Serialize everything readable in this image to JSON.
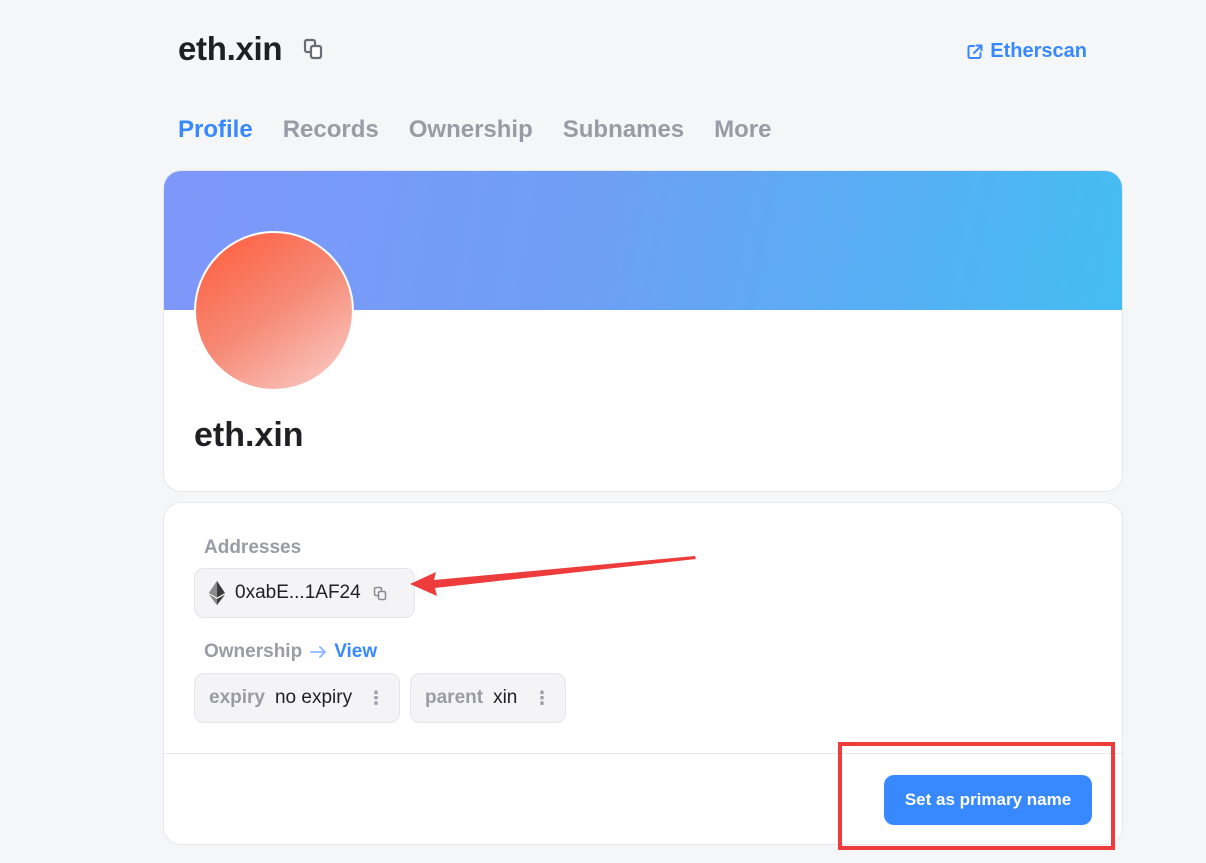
{
  "header": {
    "title": "eth.xin",
    "etherscan_label": "Etherscan"
  },
  "tabs": [
    {
      "label": "Profile",
      "active": true
    },
    {
      "label": "Records",
      "active": false
    },
    {
      "label": "Ownership",
      "active": false
    },
    {
      "label": "Subnames",
      "active": false
    },
    {
      "label": "More",
      "active": false
    }
  ],
  "profile": {
    "name": "eth.xin"
  },
  "details": {
    "addresses_label": "Addresses",
    "address": "0xabE...1AF24",
    "address_icon": "ethereum-icon",
    "ownership_label": "Ownership",
    "view_label": "View",
    "expiry": {
      "key": "expiry",
      "value": "no expiry"
    },
    "parent": {
      "key": "parent",
      "value": "xin"
    },
    "primary_button": "Set as primary name"
  },
  "colors": {
    "accent": "#3889ff",
    "annotation": "#ee3c3c",
    "banner_start": "#7f97fa",
    "banner_end": "#44bdf2"
  }
}
